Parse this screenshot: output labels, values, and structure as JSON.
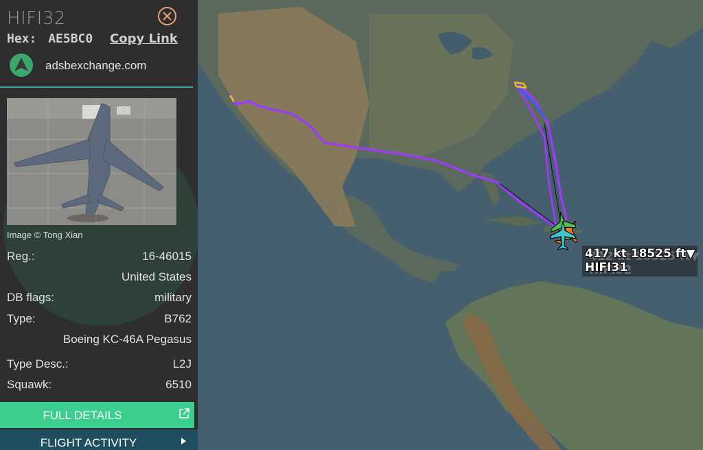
{
  "aircraft": {
    "callsign": "HIFI32",
    "hex_label": "Hex:",
    "hex_value": "AE5BC0",
    "copy_link_label": "Copy Link",
    "site_name": "adsbexchange.com",
    "image_credit": "Image © Tong Xian"
  },
  "details": {
    "rows": [
      {
        "key": "Reg.:",
        "value": "16-46015"
      },
      {
        "key": "",
        "value": "United States"
      },
      {
        "key": "DB flags:",
        "value": "military"
      },
      {
        "key": "Type:",
        "value": "B762"
      },
      {
        "key": "",
        "value": "Boeing KC-46A Pegasus"
      },
      {
        "key": "Type Desc.:",
        "value": "L2J"
      },
      {
        "key": "Squawk:",
        "value": "6510"
      }
    ]
  },
  "buttons": {
    "full_details": "FULL DETAILS",
    "flight_activity": "FLIGHT ACTIVITY"
  },
  "map": {
    "label_line1": "417 kt  18525 ft▼",
    "label_line2": "HIFI31",
    "ghost_line1": "412 kt  18525 ft▼",
    "ghost_line2": "HIFI32"
  },
  "icons": {
    "close": "close-circle-icon",
    "logo": "adsbexchange-logo-icon",
    "external": "external-link-icon",
    "chevron": "chevron-right-icon",
    "aircraft": "aircraft-icon"
  },
  "colors": {
    "accent_green": "#3bcf8e",
    "track_purple": "#9b3df0",
    "track_blue": "#3a5cff",
    "aircraft_cyan": "#3fc4d0"
  }
}
